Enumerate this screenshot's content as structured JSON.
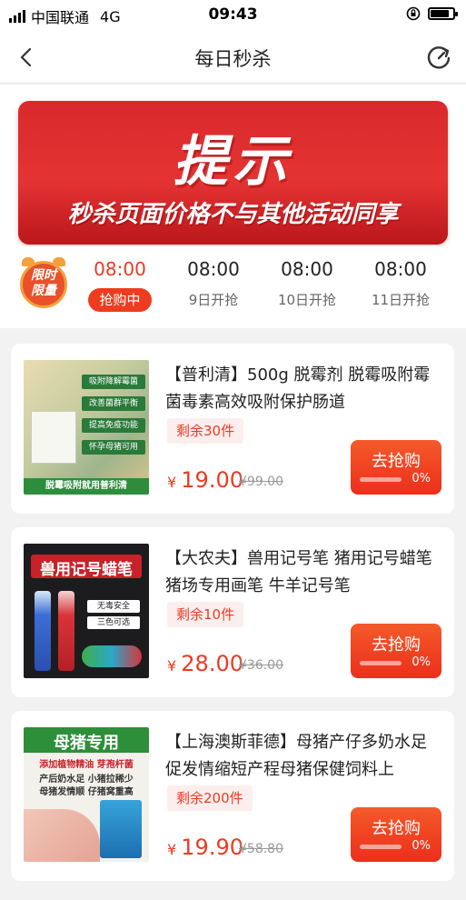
{
  "status_bar": {
    "carrier": "中国联通",
    "network": "4G",
    "time": "09:43"
  },
  "nav": {
    "title": "每日秒杀"
  },
  "notice": {
    "title": "提示",
    "subtitle": "秒杀页面价格不与其他活动同享"
  },
  "flash_badge": {
    "line1": "限时",
    "line2": "限量"
  },
  "time_slots": [
    {
      "time": "08:00",
      "status": "抢购中",
      "active": true
    },
    {
      "time": "08:00",
      "status": "9日开抢",
      "active": false
    },
    {
      "time": "08:00",
      "status": "10日开抢",
      "active": false
    },
    {
      "time": "08:00",
      "status": "11日开抢",
      "active": false
    }
  ],
  "products": [
    {
      "title": "【普利清】500g 脱霉剂 脱霉吸附霉菌毒素高效吸附保护肠道",
      "stock": "剩余30件",
      "currency": "¥",
      "price": "19.00",
      "original_price": "¥99.00",
      "button": "去抢购",
      "progress_percent": "0%",
      "progress": 0,
      "thumb_texts": [
        "吸附降解霉菌",
        "改善菌群平衡",
        "提高免疫功能",
        "怀孕母猪可用",
        "脱霉吸附就用普利清"
      ]
    },
    {
      "title": "【大农夫】兽用记号笔 猪用记号蜡笔 猪场专用画笔 牛羊记号笔",
      "stock": "剩余10件",
      "currency": "¥",
      "price": "28.00",
      "original_price": "¥36.00",
      "button": "去抢购",
      "progress_percent": "0%",
      "progress": 0,
      "thumb_texts": [
        "兽用记号蜡笔",
        "无毒安全",
        "三色可选"
      ]
    },
    {
      "title": "【上海澳斯菲德】母猪产仔多奶水足促发情缩短产程母猪保健饲料上",
      "stock": "剩余200件",
      "currency": "¥",
      "price": "19.90",
      "original_price": "¥58.80",
      "button": "去抢购",
      "progress_percent": "0%",
      "progress": 0,
      "thumb_texts": [
        "母猪专用",
        "添加植物精油  芽孢杆菌",
        "产后奶水足  小猪拉稀少",
        "母猪发情顺  仔猪窝重高"
      ]
    }
  ],
  "colors": {
    "accent": "#ec3b22",
    "banner": "#d9292b",
    "badge": "#e8512a"
  }
}
